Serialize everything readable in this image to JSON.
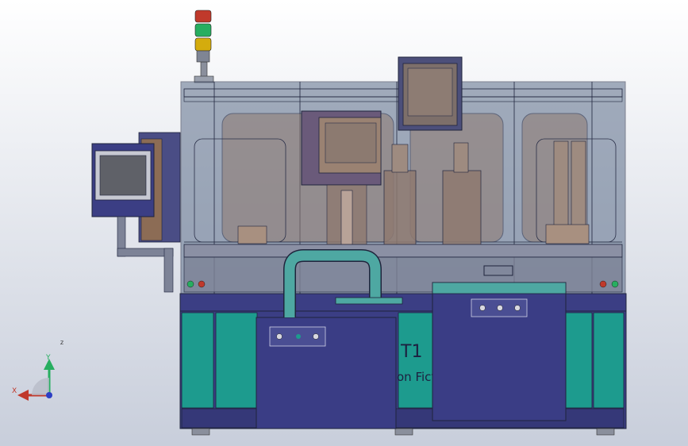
{
  "viewport": {
    "background_top": "#ffffff",
    "background_bottom": "#c8cedb"
  },
  "machine": {
    "cabinet_text_1": "T1",
    "cabinet_text_2": "on Fictio",
    "colors": {
      "cabinet": "#3b3e84",
      "teal_panel": "#1d9b8e",
      "enclosure": "#5c6e8a",
      "station_bg": "#8f7a70",
      "monitor_frame": "#36386f",
      "duct": "#4ea8a2",
      "frame_line": "#1f243c"
    },
    "signal_tower": [
      "#c0392b",
      "#27ae60",
      "#d4ac0d"
    ]
  },
  "triad": {
    "x_label": "X",
    "y_label": "Y",
    "z_label": "Z",
    "x_color": "#c0392b",
    "y_color": "#27ae60",
    "z_color": "#2c3ec4"
  }
}
